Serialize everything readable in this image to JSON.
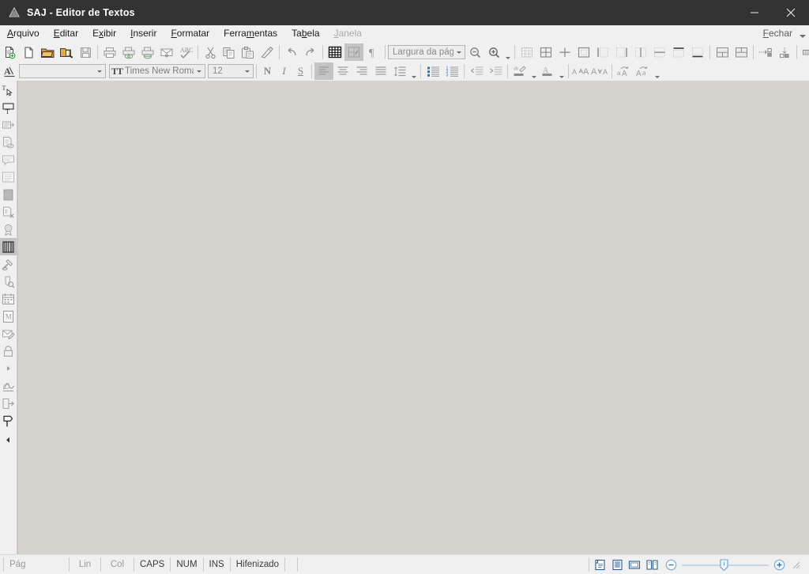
{
  "window": {
    "title": "SAJ - Editor de Textos",
    "app_icon": "saj-logo-icon",
    "minimize_label": "–",
    "close_label": "✕"
  },
  "menubar": {
    "items": [
      {
        "label": "Arquivo",
        "accel_index": 0,
        "disabled": false,
        "name": "menu-arquivo"
      },
      {
        "label": "Editar",
        "accel_index": 0,
        "disabled": false,
        "name": "menu-editar"
      },
      {
        "label": "Exibir",
        "accel_index": 1,
        "disabled": false,
        "name": "menu-exibir"
      },
      {
        "label": "Inserir",
        "accel_index": 0,
        "disabled": false,
        "name": "menu-inserir"
      },
      {
        "label": "Formatar",
        "accel_index": 0,
        "disabled": false,
        "name": "menu-formatar"
      },
      {
        "label": "Ferramentas",
        "accel_index": 5,
        "disabled": false,
        "name": "menu-ferramentas"
      },
      {
        "label": "Tabela",
        "accel_index": 2,
        "disabled": false,
        "name": "menu-tabela"
      },
      {
        "label": "Janela",
        "accel_index": 0,
        "disabled": true,
        "name": "menu-janela"
      }
    ],
    "close_doc_label": "Fechar",
    "close_doc_accel_index": 0
  },
  "toolbar_main": {
    "buttons": [
      {
        "name": "new-document-button",
        "tip": "Novo documento"
      },
      {
        "name": "blank-page-button",
        "tip": "Nova página"
      },
      {
        "name": "open-folder-button",
        "tip": "Abrir"
      },
      {
        "name": "open-model-button",
        "tip": "Abrir modelo"
      },
      {
        "name": "save-button",
        "tip": "Salvar"
      },
      {
        "name": "print-button",
        "tip": "Imprimir"
      },
      {
        "name": "print-preview-button",
        "tip": "Visualizar impressão"
      },
      {
        "name": "print-options-button",
        "tip": "Opções de impressão"
      },
      {
        "name": "send-mail-button",
        "tip": "Enviar por e-mail"
      },
      {
        "name": "spellcheck-button",
        "tip": "Ortografia"
      },
      {
        "name": "cut-button",
        "tip": "Recortar"
      },
      {
        "name": "copy-button",
        "tip": "Copiar"
      },
      {
        "name": "paste-button",
        "tip": "Colar"
      },
      {
        "name": "format-painter-button",
        "tip": "Pincel de formatação"
      },
      {
        "name": "undo-button",
        "tip": "Desfazer"
      },
      {
        "name": "redo-button",
        "tip": "Refazer"
      },
      {
        "name": "show-grid-button",
        "tip": "Exibir grade"
      },
      {
        "name": "show-fields-button",
        "tip": "Exibir campos"
      },
      {
        "name": "show-marks-button",
        "tip": "Marcas de parágrafo"
      }
    ],
    "zoom_select_value": "Largura da págin",
    "zoom_out_name": "zoom-out-button",
    "zoom_in_name": "zoom-in-button",
    "table_buttons": [
      {
        "name": "insert-table-button"
      },
      {
        "name": "table-borders-all-button"
      },
      {
        "name": "table-split-cross-button"
      },
      {
        "name": "table-border-outline-button"
      },
      {
        "name": "table-border-left-button"
      },
      {
        "name": "table-border-right-button"
      },
      {
        "name": "table-border-inside-v-button"
      },
      {
        "name": "table-border-inside-h-button"
      },
      {
        "name": "table-border-top-button"
      },
      {
        "name": "table-border-bottom-button"
      },
      {
        "name": "merge-cells-button"
      },
      {
        "name": "split-cells-button"
      },
      {
        "name": "insert-row-button"
      },
      {
        "name": "insert-column-button"
      },
      {
        "name": "distribute-rows-button"
      },
      {
        "name": "distribute-columns-button"
      },
      {
        "name": "table-autoformat-button"
      }
    ],
    "overflow_label": "»"
  },
  "toolbar_format": {
    "style_select_value": "",
    "style_select_placeholder": "",
    "font_name_value": "Times New Romar",
    "font_size_value": "12",
    "bold_label": "N",
    "italic_label": "I",
    "underline_label": "S",
    "buttons": [
      {
        "name": "align-left-button"
      },
      {
        "name": "align-center-button"
      },
      {
        "name": "align-right-button"
      },
      {
        "name": "align-justify-button"
      },
      {
        "name": "line-spacing-button"
      },
      {
        "name": "bullet-list-button"
      },
      {
        "name": "numbered-list-button"
      },
      {
        "name": "decrease-indent-button"
      },
      {
        "name": "increase-indent-button"
      },
      {
        "name": "highlight-color-button"
      },
      {
        "name": "font-color-button"
      },
      {
        "name": "increase-font-size-button"
      },
      {
        "name": "decrease-font-size-button"
      },
      {
        "name": "uppercase-button"
      },
      {
        "name": "lowercase-button"
      }
    ],
    "text-style-button": "text-style-button"
  },
  "left_rail": {
    "buttons": [
      {
        "name": "select-text-tool-button"
      },
      {
        "name": "text-box-tool-button"
      },
      {
        "name": "insert-field-button"
      },
      {
        "name": "document-properties-button"
      },
      {
        "name": "comment-button"
      },
      {
        "name": "list-items-button"
      },
      {
        "name": "page-break-button"
      },
      {
        "name": "remove-field-button"
      },
      {
        "name": "seal-stamp-button"
      },
      {
        "name": "barcode-button"
      },
      {
        "name": "gavel-button"
      },
      {
        "name": "attachment-search-button"
      },
      {
        "name": "calendar-button"
      },
      {
        "name": "model-manager-button"
      },
      {
        "name": "envelope-edit-button"
      },
      {
        "name": "lock-document-button"
      },
      {
        "name": "expand-more-button"
      },
      {
        "name": "signature-button"
      },
      {
        "name": "export-button"
      },
      {
        "name": "flag-marker-button"
      },
      {
        "name": "collapse-rail-button"
      }
    ]
  },
  "statusbar": {
    "page_label": "Pág",
    "line_label": "Lin",
    "col_label": "Col",
    "caps_label": "CAPS",
    "num_label": "NUM",
    "ins_label": "INS",
    "hyphen_label": "Hifenizado",
    "view_buttons": [
      {
        "name": "view-normal-button"
      },
      {
        "name": "view-print-layout-button"
      },
      {
        "name": "view-web-layout-button"
      },
      {
        "name": "view-two-page-button"
      }
    ],
    "zoom_out_name": "status-zoom-out-button",
    "zoom_in_name": "status-zoom-in-button",
    "zoom_slider_name": "status-zoom-slider",
    "zoom_slider_value": 44
  },
  "colors": {
    "titlebar_bg": "#333333",
    "chrome_bg": "#f0f0f0",
    "canvas_bg": "#d6d3ce",
    "accent_blue": "#2a72c8",
    "icon_gray": "#8c8c8c",
    "folder_orange": "#e09a2a",
    "green_plus": "#2e9e3e"
  }
}
